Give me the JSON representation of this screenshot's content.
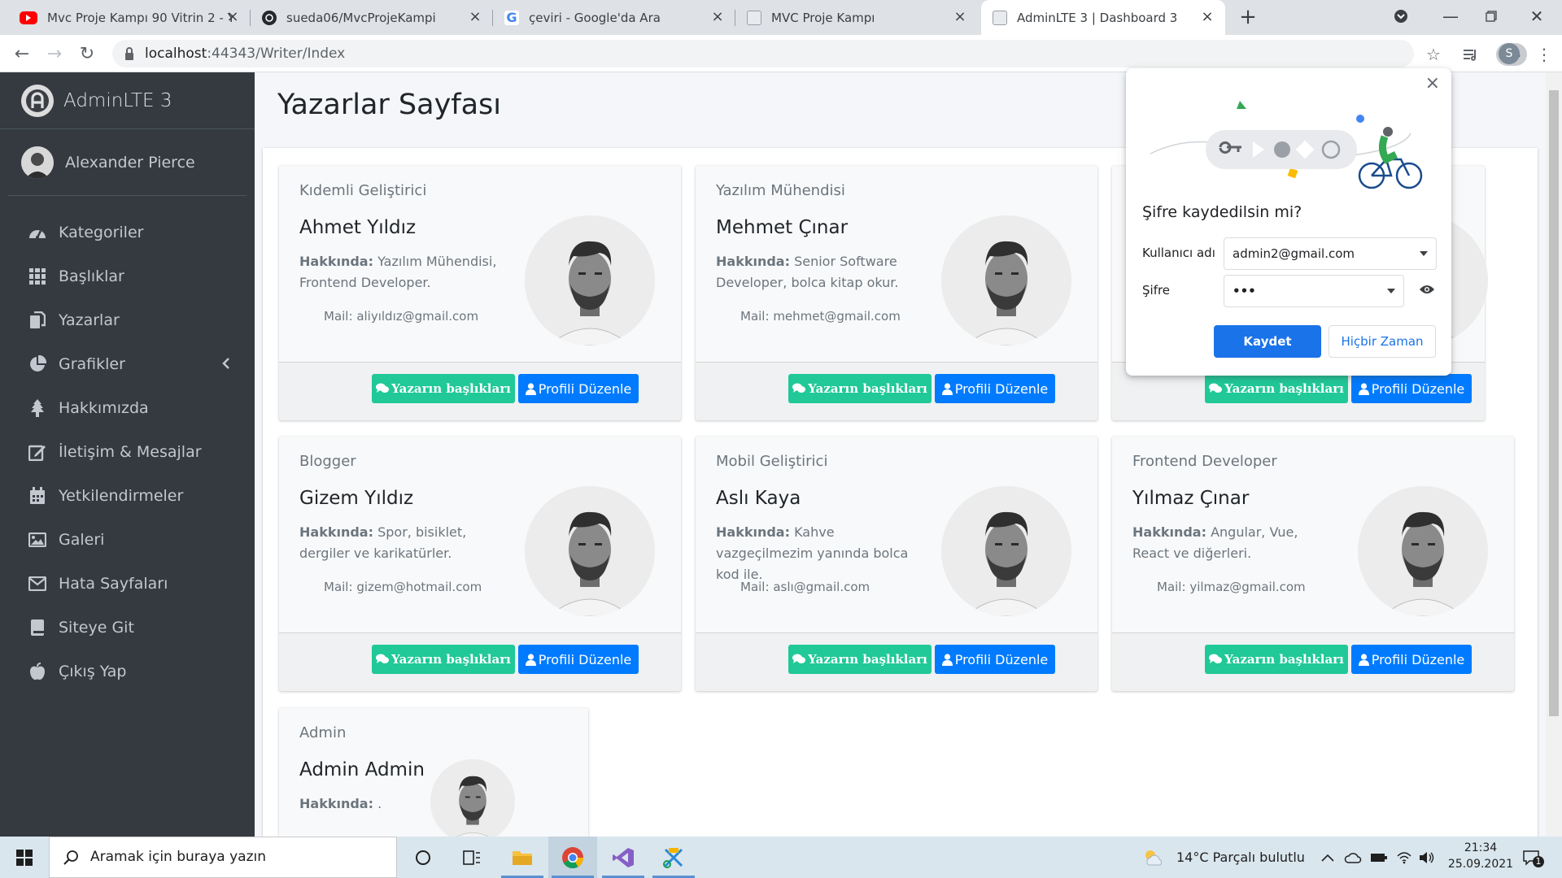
{
  "browser": {
    "tabs": [
      {
        "title": "Mvc Proje Kampı 90 Vitrin 2 - YouTube",
        "icon": "youtube-icon"
      },
      {
        "title": "sueda06/MvcProjeKampi",
        "icon": "github-icon"
      },
      {
        "title": "çeviri - Google'da Ara",
        "icon": "google-icon"
      },
      {
        "title": "MVC Proje Kampı",
        "icon": "page-icon"
      },
      {
        "title": "AdminLTE 3 | Dashboard 3",
        "icon": "page-icon"
      }
    ],
    "url_host": "localhost",
    "url_rest": ":44343/Writer/Index",
    "profile_initial": "S"
  },
  "sidebar": {
    "brand": "AdminLTE 3",
    "user": "Alexander Pierce",
    "items": [
      {
        "label": "Kategoriler",
        "icon": "dashboard-icon"
      },
      {
        "label": "Başlıklar",
        "icon": "grid-icon"
      },
      {
        "label": "Yazarlar",
        "icon": "copy-icon"
      },
      {
        "label": "Grafikler",
        "icon": "pie-chart-icon"
      },
      {
        "label": "Hakkımızda",
        "icon": "tree-icon"
      },
      {
        "label": "İletişim & Mesajlar",
        "icon": "edit-icon"
      },
      {
        "label": "Yetkilendirmeler",
        "icon": "calendar-icon"
      },
      {
        "label": "Galeri",
        "icon": "image-icon"
      },
      {
        "label": "Hata Sayfaları",
        "icon": "envelope-icon"
      },
      {
        "label": "Siteye Git",
        "icon": "book-icon"
      },
      {
        "label": "Çıkış Yap",
        "icon": "apple-icon"
      }
    ]
  },
  "page": {
    "title": "Yazarlar Sayfası",
    "about_label": "Hakkında:",
    "mail_label": "Mail:",
    "btn_titles": "Yazarın başlıkları",
    "btn_edit": "Profili Düzenle"
  },
  "writers": [
    {
      "role": "Kıdemli Geliştirici",
      "name": "Ahmet Yıldız",
      "about": "Yazılım Mühendisi, Frontend Developer.",
      "mail": "aliyıldız@gmail.com"
    },
    {
      "role": "Yazılım Mühendisi",
      "name": "Mehmet Çınar",
      "about": "Senior Software Developer, bolca kitap okur.",
      "mail": "mehmet@gmail.com"
    },
    {
      "role": "",
      "name": "",
      "about": "",
      "mail": ""
    },
    {
      "role": "Blogger",
      "name": "Gizem Yıldız",
      "about": "Spor, bisiklet, dergiler ve karikatürler.",
      "mail": "gizem@hotmail.com"
    },
    {
      "role": "Mobil Geliştirici",
      "name": "Aslı Kaya",
      "about": "Kahve vazgeçilmezim yanında bolca kod ile.",
      "mail": "aslı@gmail.com"
    },
    {
      "role": "Frontend Developer",
      "name": "Yılmaz Çınar",
      "about": "Angular, Vue, React ve diğerleri.",
      "mail": "yilmaz@gmail.com"
    },
    {
      "role": "Admin",
      "name": "Admin Admin",
      "about": ".",
      "mail": ""
    }
  ],
  "password_popup": {
    "title": "Şifre kaydedilsin mi?",
    "username_label": "Kullanıcı adı",
    "username_value": "admin2@gmail.com",
    "password_label": "Şifre",
    "password_value": "•••",
    "save_label": "Kaydet",
    "never_label": "Hiçbir Zaman"
  },
  "taskbar": {
    "search_placeholder": "Aramak için buraya yazın",
    "weather": "14°C  Parçalı bulutlu",
    "time": "21:34",
    "date": "25.09.2021",
    "notification_count": "1"
  }
}
